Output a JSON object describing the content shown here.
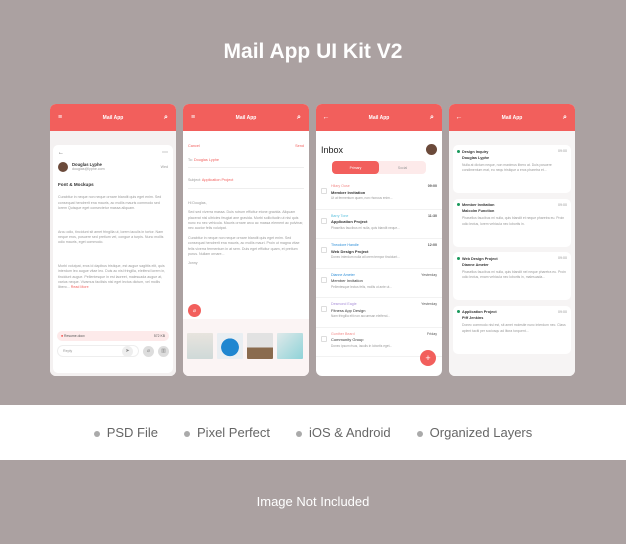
{
  "title": "Mail App UI Kit V2",
  "app_name": "Mail App",
  "colors": {
    "accent": "#f25f5c",
    "background": "#aba1a1"
  },
  "detail": {
    "sender": "Douglas Lyphe",
    "email": "douglas@lyphe.com",
    "date": "Wed",
    "subject": "Font & Mockups",
    "paragraphs": [
      "Curabitur in neque non neque ornare blandit quis eget enim. Sed consequat hendrerit ena mauris, ac mollis mauris commodo sed lorem Quisque eget consectetur massa aliquam.",
      "Arcu odio, tincidunt sit amet fringilla ut, lorem iaculis in tortor. Nam neque eros, posuere sed pretium vel, congue a turpis. Nunc mollis odio mauris, eget commodo.",
      "Morbi volutpat, eros id dapibus tristique, est augue sagittis elit, quis interdum leo augue vitae leo. Duis ac nisl fringilla, eleifend lorem in, tincidunt augue. Pellentesque in est laoreet, malesuada augue at, varius neque. Vivamus facilisis nisl eget lectus dictum, vel mollis libero..."
    ],
    "read_more": "Read More",
    "attachment": "Resume.docx",
    "attachment_size": "572 KB",
    "reply_placeholder": "Reply"
  },
  "compose": {
    "cancel": "Cancel",
    "send": "Send",
    "to_label": "To:",
    "to": "Douglas Lyphe",
    "subject_label": "Subject:",
    "subject": "Application Project",
    "greeting": "Hi Douglas,",
    "paragraphs": [
      "Sed sed viverra massa. Duis rutrum efficitur etone gravida. Aliquam placerat nisl ultricies feugiat ane gravida. Morbi sollicitudin ut nisi quis nunc eu nec vehicula. Mauris ornare arcu ac massa element ac pulvinar, nec auctor felis volutpat.",
      "Curabitur in neque non neque ornare blandit quis eget enim. Sed consequat hendrerit ena mauris, ac mollis mauri. Proin ut magna vitae felis viverra fermentum in at sem. Duis eget efficitur quam, et pretium purus. Nullam ornare..."
    ],
    "signature": "Jonny"
  },
  "inbox": {
    "title": "Inbox",
    "tabs": [
      "Primary",
      "Social"
    ],
    "items": [
      {
        "name": "Hilary Ouse",
        "color": "#f28a88",
        "time": "09:00",
        "subject": "Member Invitation",
        "preview": "Ut at fermentum quam, non rhoncus enim...",
        "unread": true
      },
      {
        "name": "Barry Tone",
        "color": "#5bc0de",
        "time": "11:30",
        "subject": "Application Project",
        "preview": "Phasellus faucibus mi nulla, quis blandit neque...",
        "unread": true
      },
      {
        "name": "Theodore Handle",
        "color": "#2f8fd8",
        "time": "12:00",
        "subject": "Web Design Project",
        "preview": "Donec interdum nulla at lorem tempor tincidunt...",
        "unread": true
      },
      {
        "name": "Dianne Ameter",
        "color": "#2f8fd8",
        "time": "Yesterday",
        "subject": "Member Invitation",
        "preview": "Pellentesque lectus felis, mollis ut ante ut...",
        "unread": false
      },
      {
        "name": "Desmond Eagle",
        "color": "#a98fd8",
        "time": "Yesterday",
        "subject": "Fitness App Design",
        "preview": "Nam fringilla elit non accumsan eleifend...",
        "unread": false
      },
      {
        "name": "Gunther Beard",
        "color": "#f28a88",
        "time": "Friday",
        "subject": "Community Group",
        "preview": "Donec ipsum risus, iaculis in lobortis eget...",
        "unread": false
      }
    ]
  },
  "notifications": [
    {
      "subject": "Design Inquiry",
      "name": "Douglas Lyphe",
      "time": "09:00",
      "preview": "Nulla at dictum neque, non maximus libero at. Duis posuere condimentum erat, eu nequ tristique a eros pharetra et..."
    },
    {
      "subject": "Member Invitation",
      "name": "Malcolm Function",
      "time": "09:00",
      "preview": "Phasellus faucibus mi nulla, quis blandit et neque pharetra eu. Proin odio lectus, lorem vehicula nec lobortis in."
    },
    {
      "subject": "Web Design Project",
      "name": "Dianne Ameter",
      "time": "09:00",
      "preview": "Phasellus faucibus mi nulla, quis blandit nel neque pharetra eu. Proin odio lectus, enam vehicula nec lobortis in, malesuada..."
    },
    {
      "subject": "Application Project",
      "name": "Piff Jenkins",
      "time": "09:00",
      "preview": "Donec commodo nisl est, sit amet molestie nunc interdum nec. Class aplent taciti per sociosqu ad litora torquent..."
    }
  ],
  "features": [
    "PSD File",
    "Pixel Perfect",
    "iOS & Android",
    "Organized Layers"
  ],
  "footer": "Image Not Included"
}
